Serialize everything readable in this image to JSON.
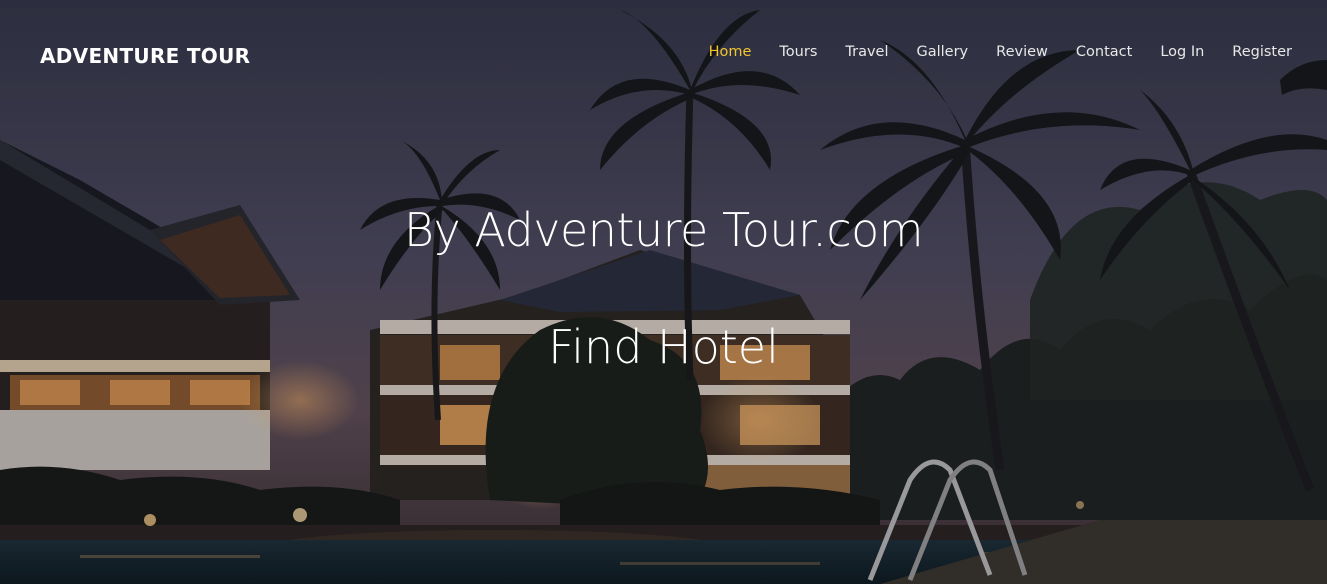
{
  "brand": {
    "name": "ADVENTURE TOUR"
  },
  "nav": {
    "items": [
      {
        "label": "Home",
        "active": true
      },
      {
        "label": "Tours",
        "active": false
      },
      {
        "label": "Travel",
        "active": false
      },
      {
        "label": "Gallery",
        "active": false
      },
      {
        "label": "Review",
        "active": false
      },
      {
        "label": "Contact",
        "active": false
      },
      {
        "label": "Log In",
        "active": false
      },
      {
        "label": "Register",
        "active": false
      }
    ],
    "active_color": "#f2c531"
  },
  "hero": {
    "title": "By Adventure Tour.com",
    "subtitle": "Find Hotel",
    "background_image": "night resort hotel with palm trees and swimming pool"
  }
}
